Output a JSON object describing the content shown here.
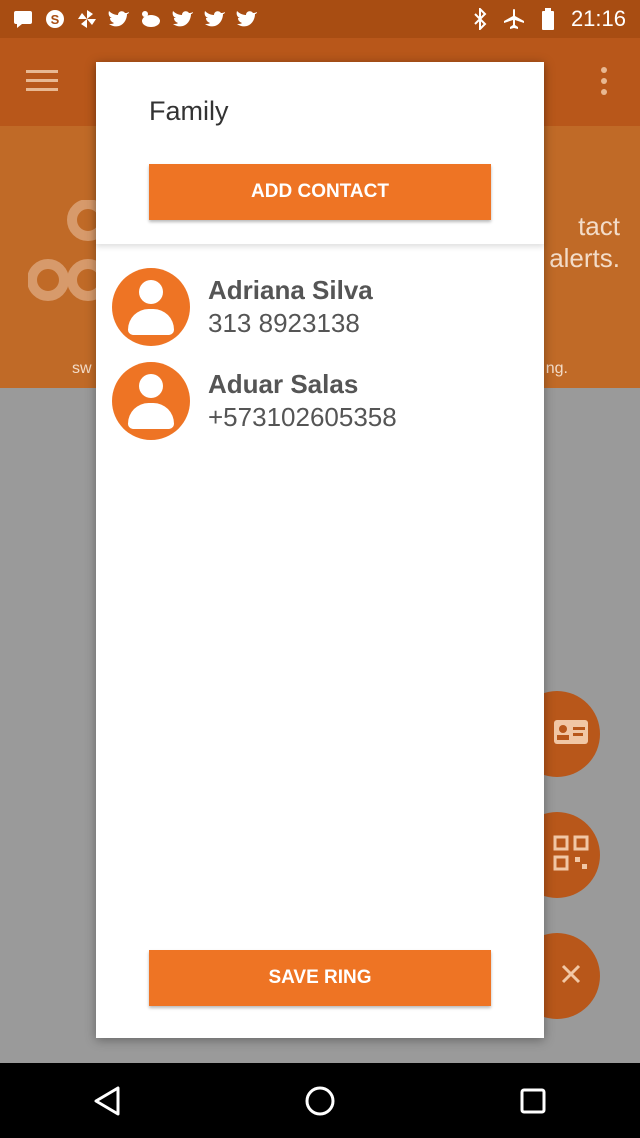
{
  "status_bar": {
    "time": "21:16"
  },
  "background": {
    "hero_text_line1": "tact",
    "hero_text_line2": "alerts.",
    "hero_sub_left": "sw",
    "hero_sub_right": "ng."
  },
  "dialog": {
    "title": "Family",
    "add_contact_label": "ADD CONTACT",
    "save_ring_label": "SAVE RING",
    "contacts": [
      {
        "name": "Adriana Silva",
        "phone": "313 8923138"
      },
      {
        "name": "Aduar Salas",
        "phone": "+573102605358"
      }
    ]
  },
  "colors": {
    "accent": "#ee7424",
    "status_bar": "#a84d12",
    "app_bar": "#b8571a"
  }
}
